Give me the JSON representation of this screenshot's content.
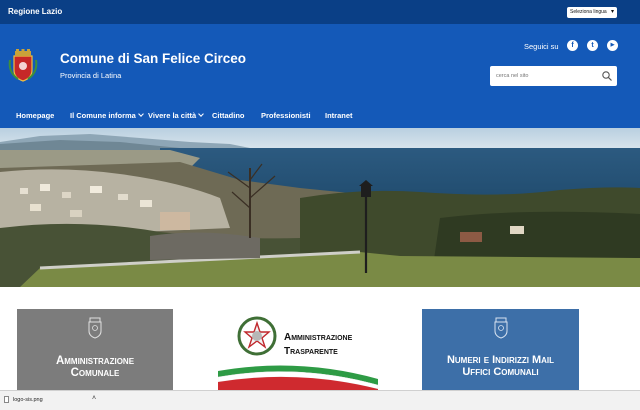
{
  "topbar": {
    "region": "Regione Lazio",
    "language_select": "Seleziona lingua"
  },
  "header": {
    "title": "Comune di San Felice Circeo",
    "subtitle": "Provincia di Latina",
    "follow_label": "Seguici su",
    "social": [
      {
        "icon": "facebook-icon",
        "glyph": "f"
      },
      {
        "icon": "twitter-icon",
        "glyph": "t"
      },
      {
        "icon": "youtube-icon",
        "glyph": "▶"
      }
    ],
    "search_placeholder": "cerca nel sito"
  },
  "nav": [
    {
      "label": "Homepage",
      "dropdown": false
    },
    {
      "label": "Il Comune informa",
      "dropdown": true
    },
    {
      "label": "Vivere la città",
      "dropdown": true
    },
    {
      "label": "Cittadino",
      "dropdown": false
    },
    {
      "label": "Professionisti",
      "dropdown": false
    },
    {
      "label": "Intranet",
      "dropdown": false
    }
  ],
  "tiles": {
    "amministrazione": {
      "line1": "Amministrazione",
      "line2": "Comunale"
    },
    "trasparente": {
      "line1": "Amministrazione",
      "line2": "Trasparente"
    },
    "numeri": {
      "line1": "Numeri e Indirizzi Mail",
      "line2": "Uffici Comunali"
    }
  },
  "download_bar": {
    "file_name": "logo-sis.png"
  },
  "colors": {
    "topbar": "#0a3f86",
    "header": "#1459b8",
    "tile_gray": "#7c7c7c",
    "tile_blue": "#3d6fa8"
  }
}
